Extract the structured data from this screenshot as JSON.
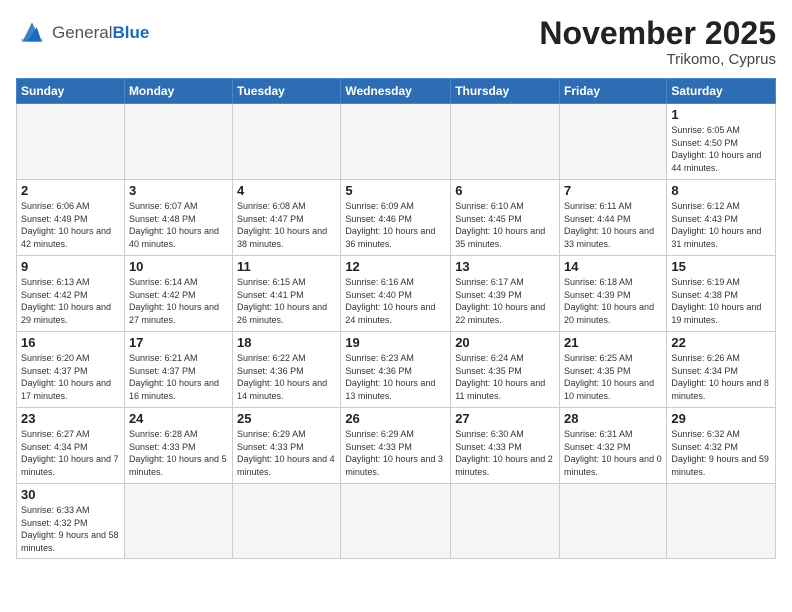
{
  "logo": {
    "general": "General",
    "blue": "Blue"
  },
  "title": "November 2025",
  "location": "Trikomo, Cyprus",
  "days_of_week": [
    "Sunday",
    "Monday",
    "Tuesday",
    "Wednesday",
    "Thursday",
    "Friday",
    "Saturday"
  ],
  "weeks": [
    [
      {
        "day": "",
        "info": ""
      },
      {
        "day": "",
        "info": ""
      },
      {
        "day": "",
        "info": ""
      },
      {
        "day": "",
        "info": ""
      },
      {
        "day": "",
        "info": ""
      },
      {
        "day": "",
        "info": ""
      },
      {
        "day": "1",
        "info": "Sunrise: 6:05 AM\nSunset: 4:50 PM\nDaylight: 10 hours and 44 minutes."
      }
    ],
    [
      {
        "day": "2",
        "info": "Sunrise: 6:06 AM\nSunset: 4:49 PM\nDaylight: 10 hours and 42 minutes."
      },
      {
        "day": "3",
        "info": "Sunrise: 6:07 AM\nSunset: 4:48 PM\nDaylight: 10 hours and 40 minutes."
      },
      {
        "day": "4",
        "info": "Sunrise: 6:08 AM\nSunset: 4:47 PM\nDaylight: 10 hours and 38 minutes."
      },
      {
        "day": "5",
        "info": "Sunrise: 6:09 AM\nSunset: 4:46 PM\nDaylight: 10 hours and 36 minutes."
      },
      {
        "day": "6",
        "info": "Sunrise: 6:10 AM\nSunset: 4:45 PM\nDaylight: 10 hours and 35 minutes."
      },
      {
        "day": "7",
        "info": "Sunrise: 6:11 AM\nSunset: 4:44 PM\nDaylight: 10 hours and 33 minutes."
      },
      {
        "day": "8",
        "info": "Sunrise: 6:12 AM\nSunset: 4:43 PM\nDaylight: 10 hours and 31 minutes."
      }
    ],
    [
      {
        "day": "9",
        "info": "Sunrise: 6:13 AM\nSunset: 4:42 PM\nDaylight: 10 hours and 29 minutes."
      },
      {
        "day": "10",
        "info": "Sunrise: 6:14 AM\nSunset: 4:42 PM\nDaylight: 10 hours and 27 minutes."
      },
      {
        "day": "11",
        "info": "Sunrise: 6:15 AM\nSunset: 4:41 PM\nDaylight: 10 hours and 26 minutes."
      },
      {
        "day": "12",
        "info": "Sunrise: 6:16 AM\nSunset: 4:40 PM\nDaylight: 10 hours and 24 minutes."
      },
      {
        "day": "13",
        "info": "Sunrise: 6:17 AM\nSunset: 4:39 PM\nDaylight: 10 hours and 22 minutes."
      },
      {
        "day": "14",
        "info": "Sunrise: 6:18 AM\nSunset: 4:39 PM\nDaylight: 10 hours and 20 minutes."
      },
      {
        "day": "15",
        "info": "Sunrise: 6:19 AM\nSunset: 4:38 PM\nDaylight: 10 hours and 19 minutes."
      }
    ],
    [
      {
        "day": "16",
        "info": "Sunrise: 6:20 AM\nSunset: 4:37 PM\nDaylight: 10 hours and 17 minutes."
      },
      {
        "day": "17",
        "info": "Sunrise: 6:21 AM\nSunset: 4:37 PM\nDaylight: 10 hours and 16 minutes."
      },
      {
        "day": "18",
        "info": "Sunrise: 6:22 AM\nSunset: 4:36 PM\nDaylight: 10 hours and 14 minutes."
      },
      {
        "day": "19",
        "info": "Sunrise: 6:23 AM\nSunset: 4:36 PM\nDaylight: 10 hours and 13 minutes."
      },
      {
        "day": "20",
        "info": "Sunrise: 6:24 AM\nSunset: 4:35 PM\nDaylight: 10 hours and 11 minutes."
      },
      {
        "day": "21",
        "info": "Sunrise: 6:25 AM\nSunset: 4:35 PM\nDaylight: 10 hours and 10 minutes."
      },
      {
        "day": "22",
        "info": "Sunrise: 6:26 AM\nSunset: 4:34 PM\nDaylight: 10 hours and 8 minutes."
      }
    ],
    [
      {
        "day": "23",
        "info": "Sunrise: 6:27 AM\nSunset: 4:34 PM\nDaylight: 10 hours and 7 minutes."
      },
      {
        "day": "24",
        "info": "Sunrise: 6:28 AM\nSunset: 4:33 PM\nDaylight: 10 hours and 5 minutes."
      },
      {
        "day": "25",
        "info": "Sunrise: 6:29 AM\nSunset: 4:33 PM\nDaylight: 10 hours and 4 minutes."
      },
      {
        "day": "26",
        "info": "Sunrise: 6:29 AM\nSunset: 4:33 PM\nDaylight: 10 hours and 3 minutes."
      },
      {
        "day": "27",
        "info": "Sunrise: 6:30 AM\nSunset: 4:33 PM\nDaylight: 10 hours and 2 minutes."
      },
      {
        "day": "28",
        "info": "Sunrise: 6:31 AM\nSunset: 4:32 PM\nDaylight: 10 hours and 0 minutes."
      },
      {
        "day": "29",
        "info": "Sunrise: 6:32 AM\nSunset: 4:32 PM\nDaylight: 9 hours and 59 minutes."
      }
    ],
    [
      {
        "day": "30",
        "info": "Sunrise: 6:33 AM\nSunset: 4:32 PM\nDaylight: 9 hours and 58 minutes."
      },
      {
        "day": "",
        "info": ""
      },
      {
        "day": "",
        "info": ""
      },
      {
        "day": "",
        "info": ""
      },
      {
        "day": "",
        "info": ""
      },
      {
        "day": "",
        "info": ""
      },
      {
        "day": "",
        "info": ""
      }
    ]
  ]
}
